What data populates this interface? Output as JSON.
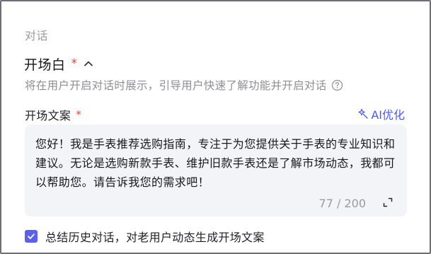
{
  "section": {
    "title": "对话"
  },
  "opening": {
    "title": "开场白",
    "required_mark": "*",
    "description": "将在用户开启对话时展示，引导用户快速了解功能并开启对话"
  },
  "opening_text_field": {
    "label": "开场文案",
    "required_mark": "*",
    "ai_button_label": "AI优化",
    "value": "您好！我是手表推荐选购指南，专注于为您提供关于手表的专业知识和建议。无论是选购新款手表、维护旧款手表还是了解市场动态，我都可以帮助您。请告诉我您的需求吧！",
    "char_count": "77 / 200"
  },
  "summary_option": {
    "checked": true,
    "label": "总结历史对话，对老用户动态生成开场文案"
  },
  "colors": {
    "accent": "#5b5ff0",
    "link": "#4d5bec",
    "required": "#f0453a",
    "muted_text": "#8e8e96",
    "textarea_bg": "#f3f4f7"
  },
  "icons": {
    "collapse": "chevron-up-icon",
    "help": "help-circle-icon",
    "ai": "magic-wand-icon",
    "expand": "expand-icon",
    "checkbox": "checkmark-icon"
  }
}
